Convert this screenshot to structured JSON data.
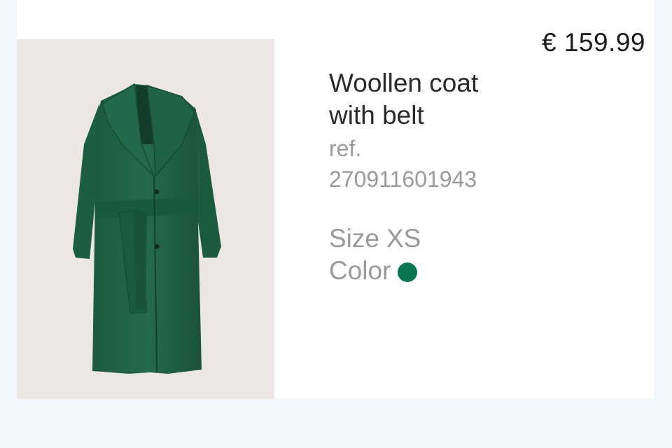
{
  "product": {
    "price": "€ 159.99",
    "title_line1": "Woollen coat",
    "title_line2": "with belt",
    "ref_label": "ref.",
    "ref_value": "270911601943",
    "size_label": "Size",
    "size_value": "XS",
    "color_label": "Color",
    "color_hex": "#0a7552",
    "image_subject": "green-wool-coat"
  }
}
